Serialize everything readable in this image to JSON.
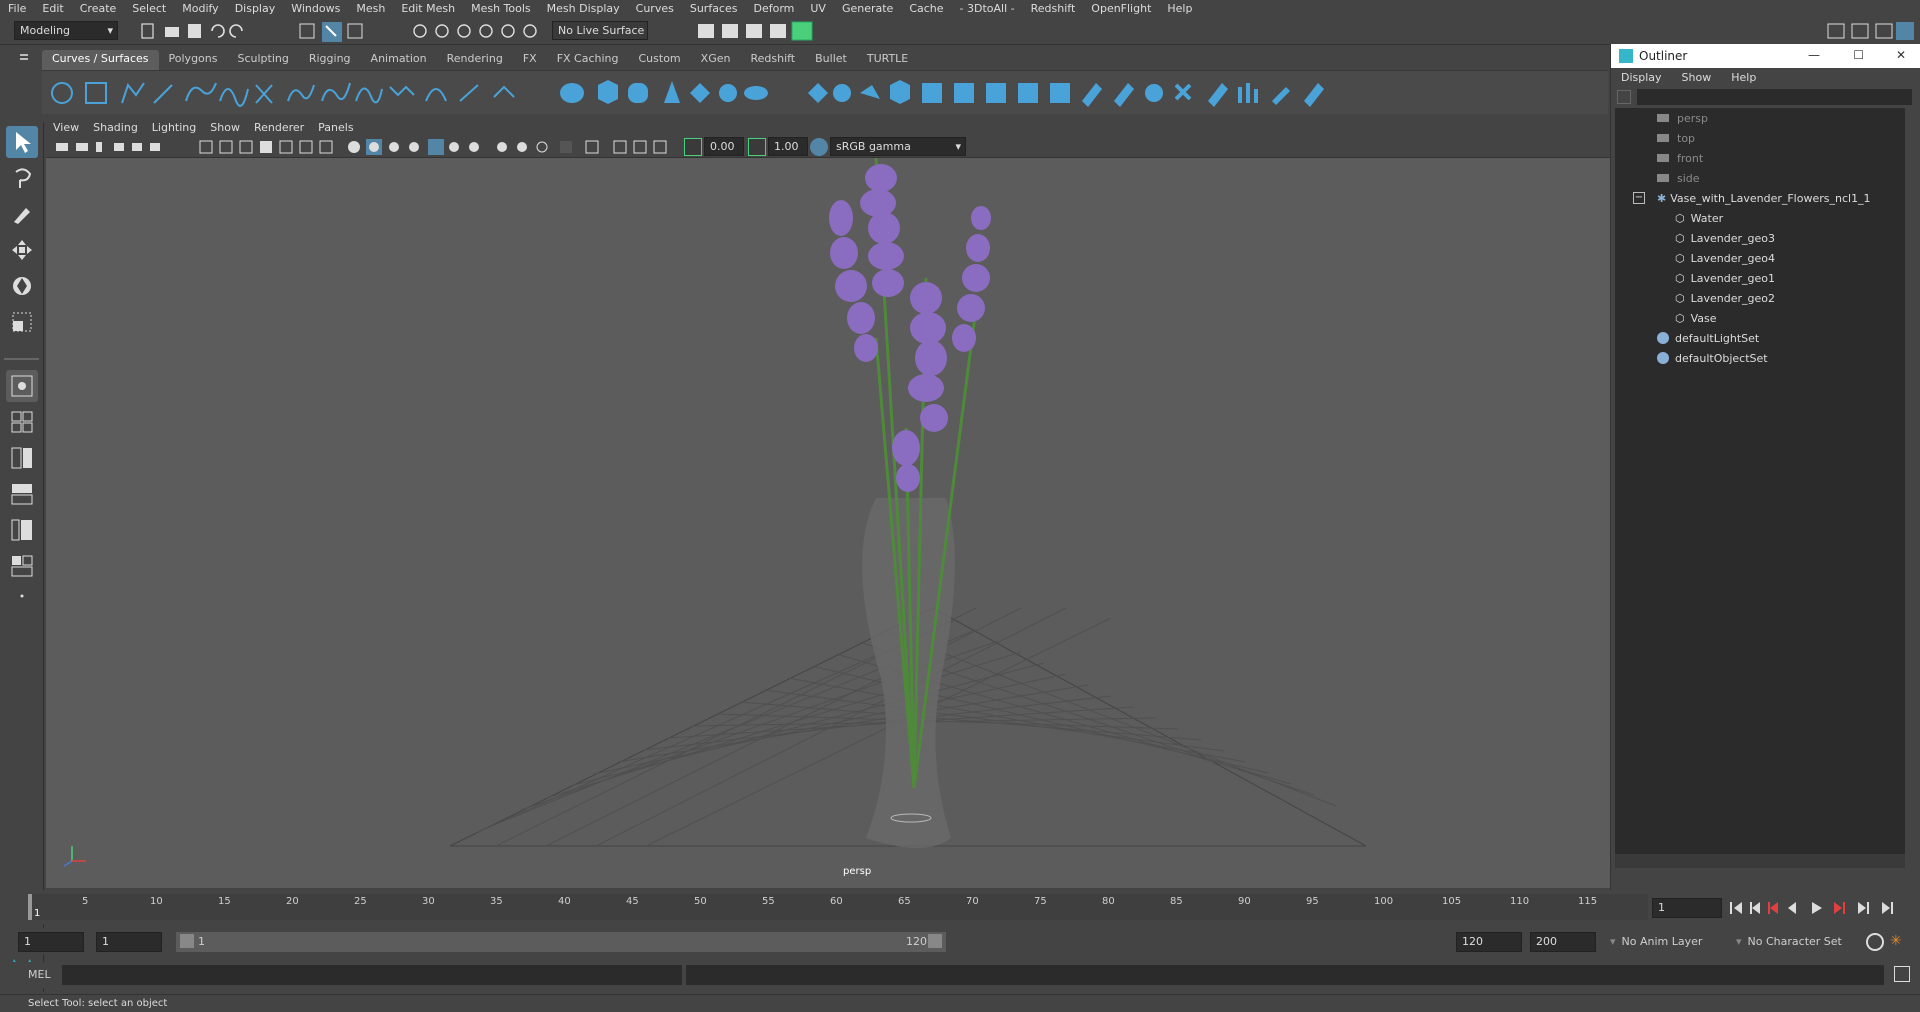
{
  "menubar": [
    "File",
    "Edit",
    "Create",
    "Select",
    "Modify",
    "Display",
    "Windows",
    "Mesh",
    "Edit Mesh",
    "Mesh Tools",
    "Mesh Display",
    "Curves",
    "Surfaces",
    "Deform",
    "UV",
    "Generate",
    "Cache",
    "- 3DtoAll -",
    "Redshift",
    "OpenFlight",
    "Help"
  ],
  "status_line": {
    "mode": "Modeling",
    "live_surface": "No Live Surface"
  },
  "shelf_tabs": [
    "Curves / Surfaces",
    "Polygons",
    "Sculpting",
    "Rigging",
    "Animation",
    "Rendering",
    "FX",
    "FX Caching",
    "Custom",
    "XGen",
    "Redshift",
    "Bullet",
    "TURTLE"
  ],
  "viewport": {
    "menu": [
      "View",
      "Shading",
      "Lighting",
      "Show",
      "Renderer",
      "Panels"
    ],
    "exposure": "0.00",
    "gamma": "1.00",
    "color_space": "sRGB gamma",
    "camera_label": "persp"
  },
  "outliner": {
    "title": "Outliner",
    "menu": [
      "Display",
      "Show",
      "Help"
    ],
    "cameras": [
      "persp",
      "top",
      "front",
      "side"
    ],
    "group": "Vase_with_Lavender_Flowers_ncl1_1",
    "children": [
      "Water",
      "Lavender_geo3",
      "Lavender_geo4",
      "Lavender_geo1",
      "Lavender_geo2",
      "Vase"
    ],
    "sets": [
      "defaultLightSet",
      "defaultObjectSet"
    ]
  },
  "timeline": {
    "ticks": [
      "5",
      "10",
      "15",
      "20",
      "25",
      "30",
      "35",
      "40",
      "45",
      "50",
      "55",
      "60",
      "65",
      "70",
      "75",
      "80",
      "85",
      "90",
      "95",
      "100",
      "105",
      "110",
      "115",
      "1"
    ],
    "current_frame": "1",
    "frame_field": "1"
  },
  "range": {
    "start": "1",
    "playback_start": "1",
    "slider_start": "1",
    "slider_end": "120",
    "playback_end": "120",
    "end": "200",
    "anim_layer": "No Anim Layer",
    "character_set": "No Character Set"
  },
  "command_line": {
    "label": "MEL"
  },
  "help_line": "Select Tool: select an object",
  "colors": {
    "accent": "#5285a6",
    "viewport_bg": "#5c5c5c",
    "outliner_bg": "#2b2b2b",
    "lavender": "#8a6cc0",
    "stem": "#4e8a3a"
  }
}
